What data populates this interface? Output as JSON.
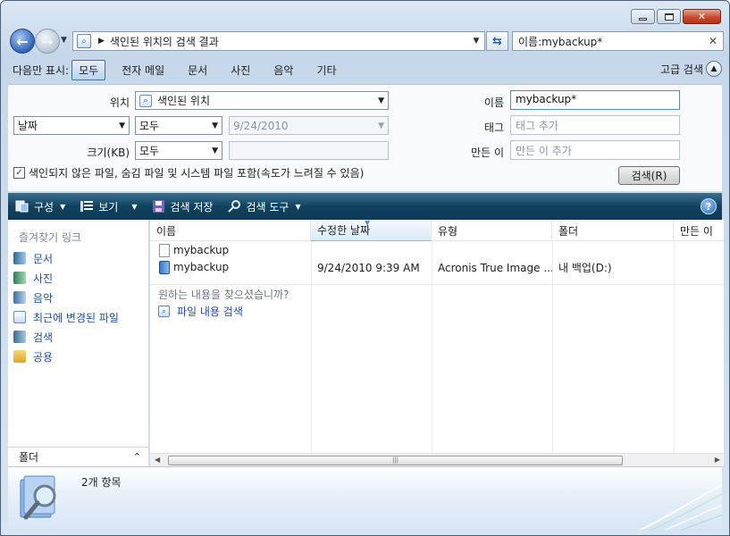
{
  "nav": {
    "back_glyph": "←",
    "address_crumb": "색인된 위치의 검색 결과",
    "search_value": "이름:mybackup*"
  },
  "filter": {
    "label": "다음만 표시:",
    "items": [
      "모두",
      "전자 메일",
      "문서",
      "사진",
      "음악",
      "기타"
    ],
    "active_index": 0,
    "advanced_label": "고급 검색"
  },
  "advanced": {
    "location_label": "위치",
    "location_value": "색인된 위치",
    "date_field": "날짜",
    "date_op": "모두",
    "date_value": "9/24/2010",
    "size_label": "크기(KB)",
    "size_op": "모두",
    "name_label": "이름",
    "name_value": "mybackup*",
    "tags_label": "태그",
    "tags_placeholder": "태그 추가",
    "author_label": "만든 이",
    "author_placeholder": "만든 이 추가",
    "include_label": "색인되지 않은 파일, 숨김 파일 및 시스템 파일 포함(속도가 느려질 수 있음)",
    "include_checked": true,
    "search_button": "검색(R)"
  },
  "toolbar": {
    "organize": "구성",
    "views": "보기",
    "save_search": "검색 저장",
    "search_tools": "검색 도구"
  },
  "sidebar": {
    "title": "즐겨찾기 링크",
    "items": [
      {
        "label": "문서",
        "icon": "documents-icon"
      },
      {
        "label": "사진",
        "icon": "pictures-icon"
      },
      {
        "label": "음악",
        "icon": "music-icon"
      },
      {
        "label": "최근에 변경된 파일",
        "icon": "recent-icon"
      },
      {
        "label": "검색",
        "icon": "searches-icon"
      },
      {
        "label": "공용",
        "icon": "public-icon"
      }
    ],
    "folders_label": "폴더"
  },
  "list": {
    "columns": [
      "이름",
      "수정한 날짜",
      "유형",
      "폴더",
      "만든 이"
    ],
    "rows": [
      {
        "name": "mybackup",
        "date": "",
        "type": "",
        "folder": "",
        "icon": "file-icon"
      },
      {
        "name": "mybackup",
        "date": "9/24/2010 9:39 AM",
        "type": "Acronis True Image ...",
        "folder": "내 백업(D:)",
        "icon": "tib-backup-icon"
      }
    ],
    "hint": "원하는 내용을 찾으셨습니까?",
    "hint_link": "파일 내용 검색"
  },
  "details": {
    "count": "2개 항목"
  }
}
